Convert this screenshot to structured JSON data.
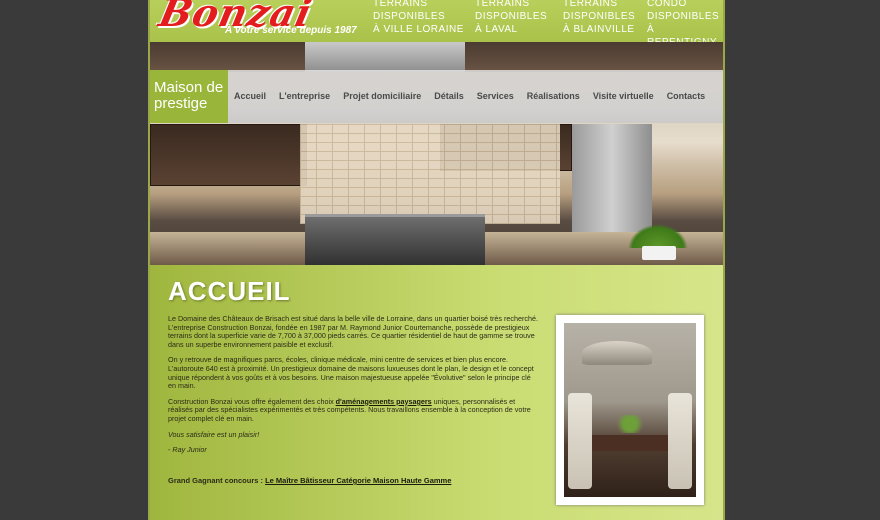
{
  "brand": {
    "logo_text": "Bonzai",
    "tagline": "À votre service depuis 1987"
  },
  "promos": [
    {
      "lines": [
        "TERRAINS",
        "DISPONIBLES",
        "À VILLE LORAINE"
      ]
    },
    {
      "lines": [
        "TERRAINS",
        "DISPONIBLES",
        "À LAVAL"
      ]
    },
    {
      "lines": [
        "TERRAINS",
        "DISPONIBLES",
        "À BLAINVILLE"
      ]
    },
    {
      "lines": [
        "CONDO",
        "DISPONIBLES",
        "À REPENTIGNY"
      ]
    }
  ],
  "section_label": "Maison de prestige",
  "nav": [
    "Accueil",
    "L'entreprise",
    "Projet domiciliaire",
    "Détails",
    "Services",
    "Réalisations",
    "Visite virtuelle",
    "Contacts"
  ],
  "page_title": "ACCUEIL",
  "paragraphs": {
    "p1": "Le Domaine des Châteaux de Brisach est situé dans la belle ville de Lorraine, dans un quartier boisé très recherché. L'entreprise Construction Bonzai, fondée en 1987 par M. Raymond Junior Courtemanche, possède de prestigieux terrains dont la superficie varie de 7,700 à 37,000 pieds carrés. Ce quartier résidentiel de haut de gamme se trouve dans un superbe environnement paisible et exclusif.",
    "p2": "On y retrouve de magnifiques parcs, écoles, clinique médicale, mini centre de services et bien plus encore. L'autoroute 640 est à proximité. Un prestigieux domaine de maisons luxueuses dont le plan, le design et le concept unique répondent à vos goûts et à vos besoins. Une maison majestueuse appelée \"Évolutive\" selon le principe clé en main.",
    "p3_before": "Construction Bonzai vous offre également des choix ",
    "p3_link": "d'aménagements paysagers",
    "p3_after": " uniques, personnalisés et réalisés par des spécialistes expérimentés et très compétents. Nous travaillons ensemble à la conception de votre projet complet clé en main.",
    "quote": "Vous satisfaire est un plaisir!",
    "signature": "- Ray Junior"
  },
  "award": {
    "prefix": "Grand Gagnant concours : ",
    "link": "Le Maître Bâtisseur Catégorie Maison Haute Gamme"
  },
  "colors": {
    "page_bg": "#3a3a3a",
    "accent_green": "#99b63b",
    "logo_red": "#e31d1d"
  }
}
